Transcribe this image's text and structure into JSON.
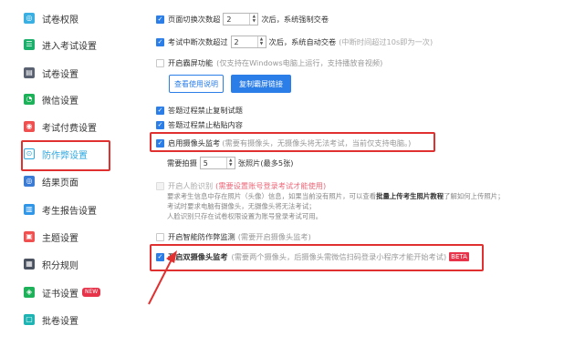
{
  "sidebar": {
    "items": [
      {
        "label": "试卷权限",
        "icon": "permission-icon",
        "color": "#3ab0e2"
      },
      {
        "label": "进入考试设置",
        "icon": "enter-exam-icon",
        "color": "#1aaf6a"
      },
      {
        "label": "试卷设置",
        "icon": "paper-settings-icon",
        "color": "#5a6170"
      },
      {
        "label": "微信设置",
        "icon": "wechat-icon",
        "color": "#1db25a"
      },
      {
        "label": "考试付费设置",
        "icon": "payment-icon",
        "color": "#f05050"
      },
      {
        "label": "防作弊设置",
        "icon": "anti-cheat-icon",
        "color": "#2fa8e0"
      },
      {
        "label": "结果页面",
        "icon": "result-page-icon",
        "color": "#3a7bd5"
      },
      {
        "label": "考生报告设置",
        "icon": "report-icon",
        "color": "#2f96e8"
      },
      {
        "label": "主题设置",
        "icon": "theme-icon",
        "color": "#f05050"
      },
      {
        "label": "积分规则",
        "icon": "points-icon",
        "color": "#4b5260"
      },
      {
        "label": "证书设置",
        "icon": "certificate-icon",
        "color": "#1db25a",
        "badge": "NEW"
      },
      {
        "label": "批卷设置",
        "icon": "grading-icon",
        "color": "#1fb4b4"
      }
    ]
  },
  "settings": {
    "switch_tabs": {
      "label_before": "页面切换次数超",
      "value": "2",
      "label_after": "次后，系统强制交卷",
      "checked": true
    },
    "interrupt": {
      "label_before": "考试中断次数超过",
      "value": "2",
      "label_after": "次后，系统自动交卷",
      "hint": "(中断时间超过10s即为一次)",
      "checked": true
    },
    "screen_record": {
      "label": "开启霸屏功能",
      "hint": "(仅支持在Windows电脑上运行，支持播放音视频)",
      "checked": false
    },
    "buttons": {
      "usage": "查看使用说明",
      "copy_link": "复制霸屏链接"
    },
    "no_copy": {
      "label": "答题过程禁止复制试题",
      "checked": true
    },
    "no_paste": {
      "label": "答题过程禁止粘贴内容",
      "checked": true
    },
    "camera": {
      "label": "启用摄像头监考",
      "hint": "(需要有摄像头，无摄像头将无法考试，当前仅支持电脑。)",
      "checked": true
    },
    "photo": {
      "label_before": "需要拍摄",
      "value": "5",
      "label_after": "张照片(最多5张)"
    },
    "face": {
      "label": "开启人脸识别",
      "hint": "(需要设置账号登录考试才能使用)",
      "note_line1_a": "要求考生信息中存在照片（头像）信息，如果当前没有照片，可以查看",
      "note_line1_b": "批量上传考生照片教程",
      "note_line1_c": "了解如何上传照片；",
      "note_line2": "考试时要求电脑有摄像头，无摄像头将无法考试；",
      "note_line3": "人脸识别只存在试卷权限设置为账号登录考试可用。",
      "checked": false
    },
    "smart": {
      "label": "开启智能防作弊监测",
      "hint": "(需要开启摄像头监考)",
      "checked": false
    },
    "dual_camera": {
      "label": "开启双摄像头监考",
      "hint": "(需要两个摄像头，后摄像头需微信扫码登录小程序才能开始考试)",
      "badge": "BETA",
      "checked": true
    }
  },
  "colors": {
    "accent": "#2b7ee8",
    "highlight": "#e03030",
    "active_nav": "#2fa8e0"
  }
}
